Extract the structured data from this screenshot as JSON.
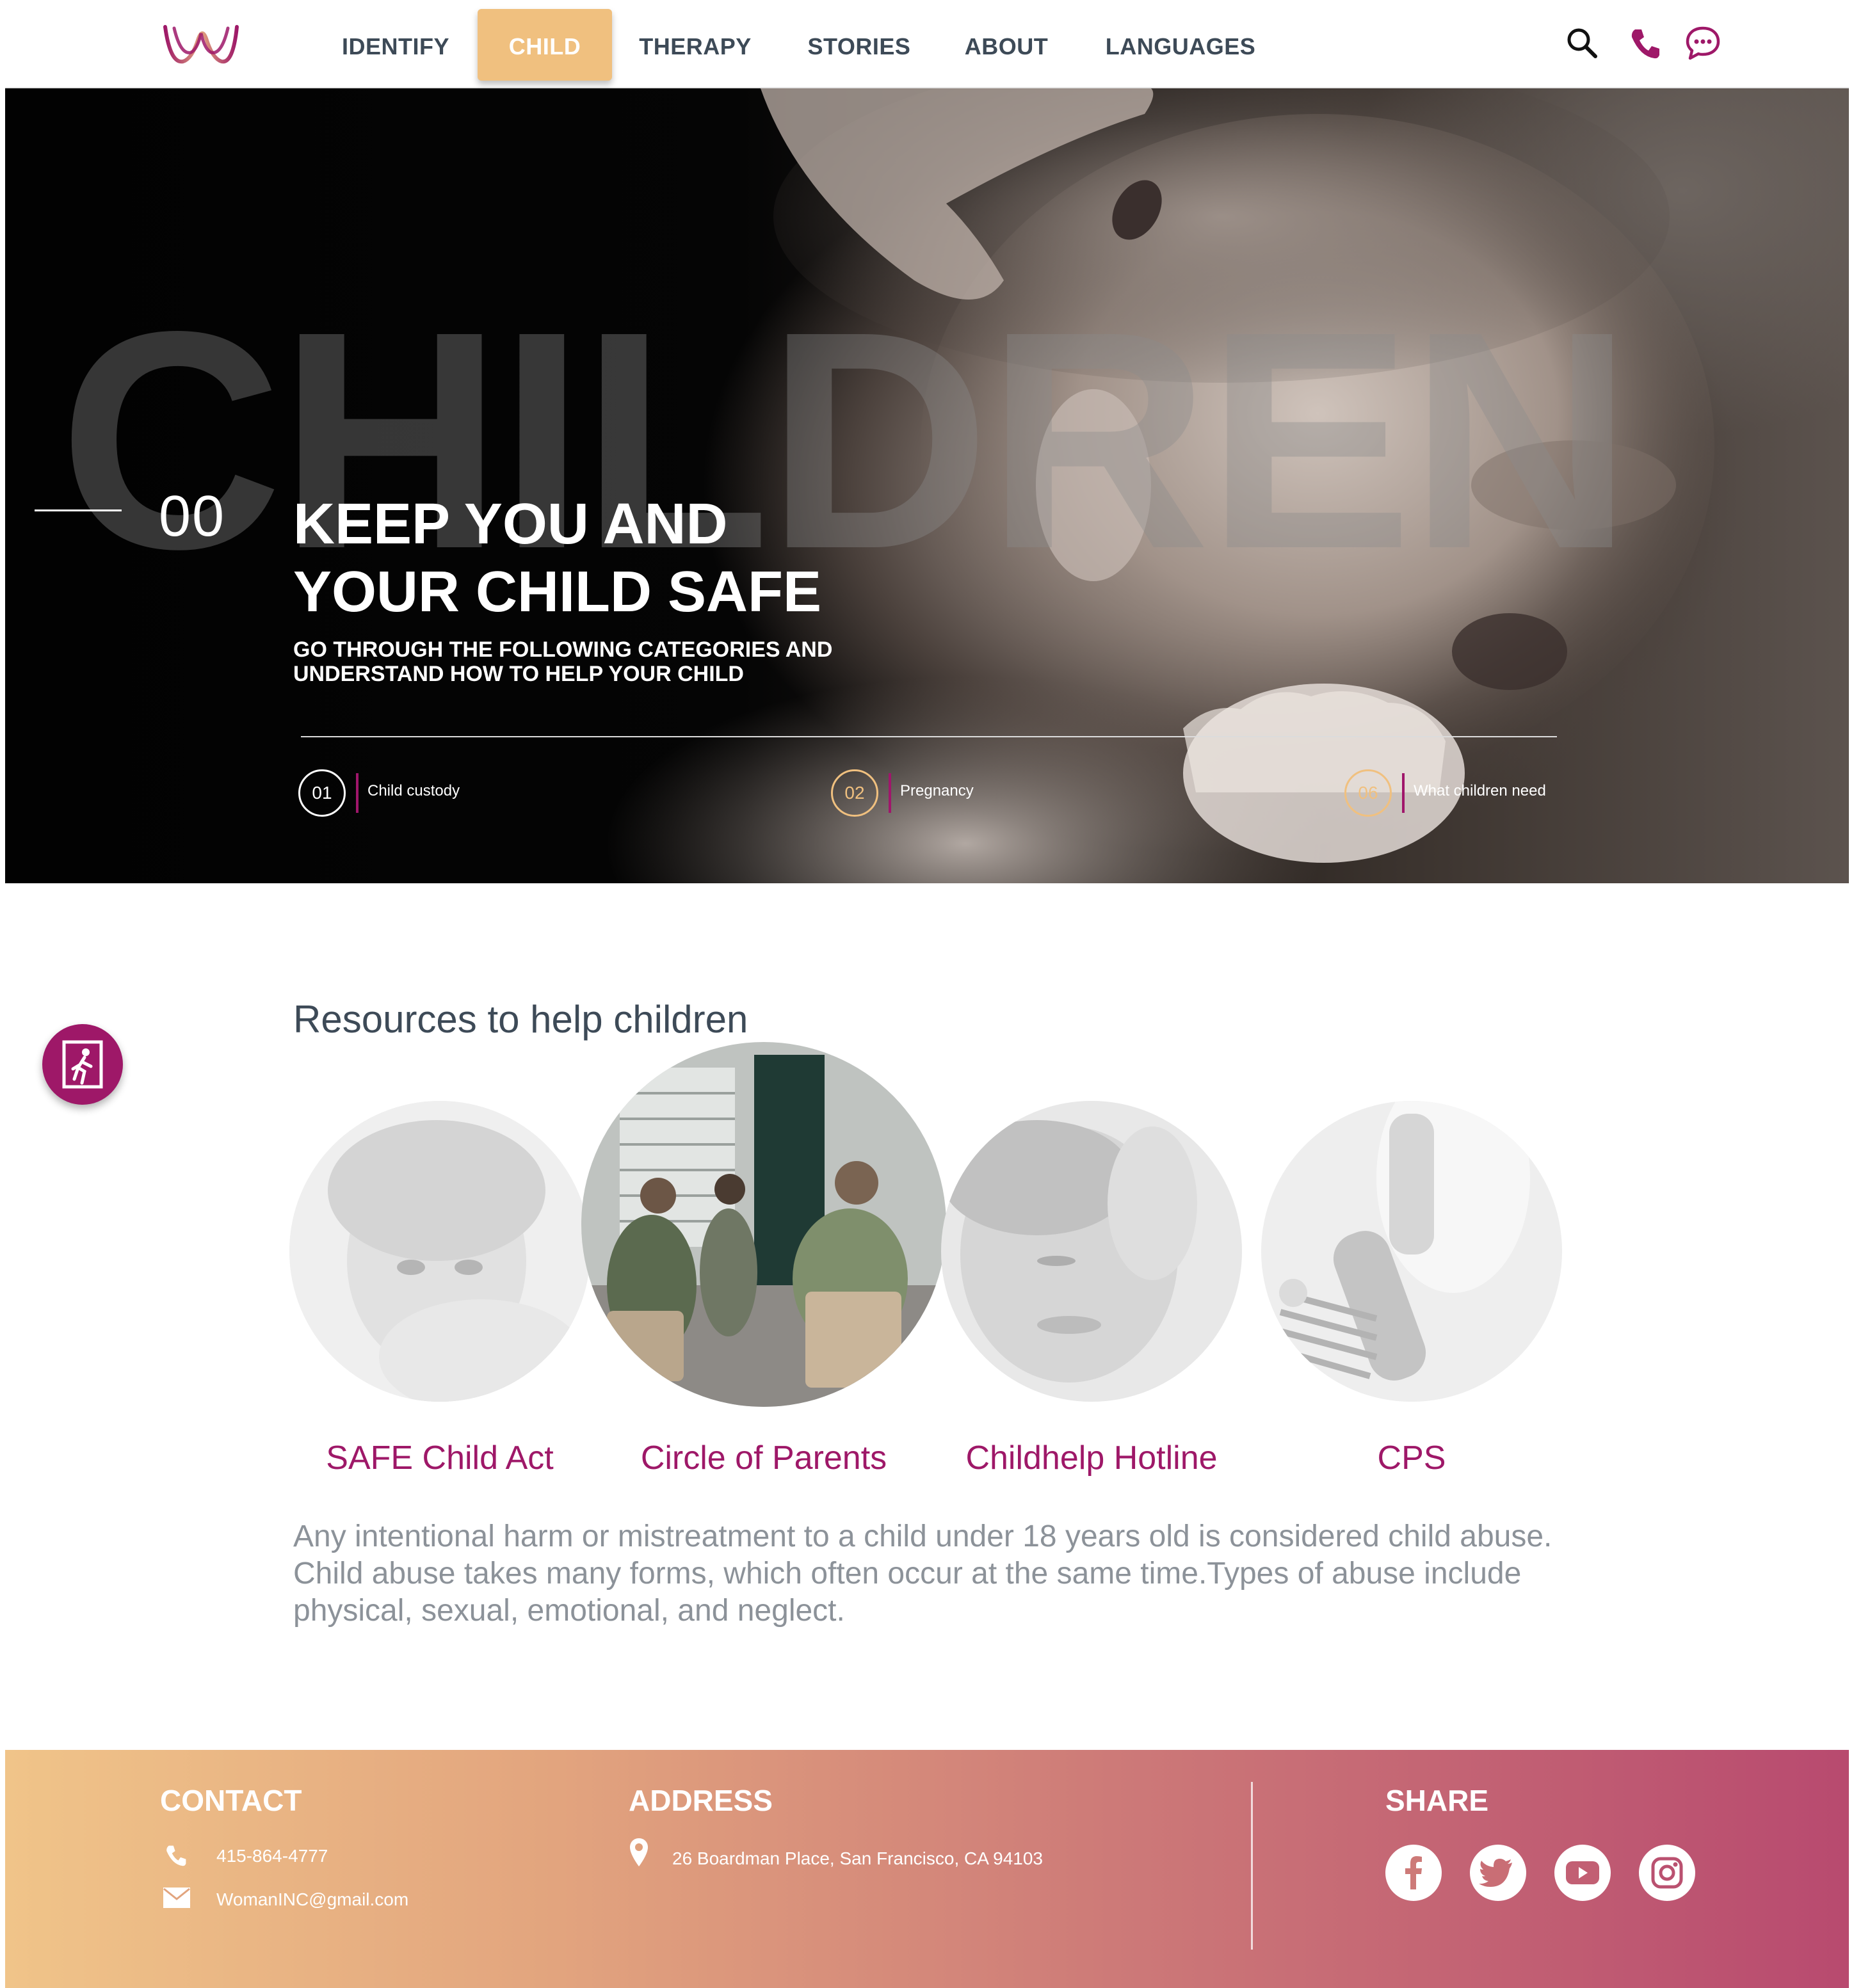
{
  "header": {
    "logo": "w-logo",
    "nav": [
      {
        "label": "IDENTIFY",
        "active": false
      },
      {
        "label": "CHILD",
        "active": true
      },
      {
        "label": "THERAPY",
        "active": false
      },
      {
        "label": "STORIES",
        "active": false
      },
      {
        "label": "ABOUT",
        "active": false
      },
      {
        "label": "LANGUAGES",
        "active": false
      }
    ],
    "icons": [
      "search-icon",
      "phone-icon",
      "chat-icon"
    ]
  },
  "hero": {
    "background_word": "CHILDREN",
    "index": "00",
    "title_line1": "KEEP YOU AND",
    "title_line2": "YOUR CHILD SAFE",
    "subtitle_line1": "GO THROUGH THE FOLLOWING CATEGORIES AND",
    "subtitle_line2": "UNDERSTAND HOW TO HELP YOUR CHILD",
    "categories": [
      {
        "num": "01",
        "label": "Child custody"
      },
      {
        "num": "02",
        "label": "Pregnancy"
      },
      {
        "num": "06",
        "label": "What children need"
      }
    ]
  },
  "resources": {
    "title": "Resources to help children",
    "items": [
      {
        "label": "SAFE Child Act",
        "selected": false
      },
      {
        "label": "Circle of Parents",
        "selected": true
      },
      {
        "label": "Childhelp Hotline",
        "selected": false
      },
      {
        "label": "CPS",
        "selected": false
      }
    ],
    "description": "Any intentional harm or mistreatment to a child under 18 years old is considered child abuse. Child abuse takes many forms, which often occur at the same time.Types of abuse include physical, sexual, emotional, and neglect."
  },
  "footer": {
    "contact_heading": "CONTACT",
    "phone": "415-864-4777",
    "email": "WomanINC@gmail.com",
    "address_heading": "ADDRESS",
    "address": "26 Boardman Place, San Francisco, CA 94103",
    "share_heading": "SHARE",
    "social": [
      "facebook-icon",
      "twitter-icon",
      "youtube-icon",
      "instagram-icon"
    ]
  },
  "colors": {
    "brand": "#9e1868",
    "accent": "#f0c07f",
    "nav_text": "#3d4a57",
    "body_text": "#8c9299"
  }
}
